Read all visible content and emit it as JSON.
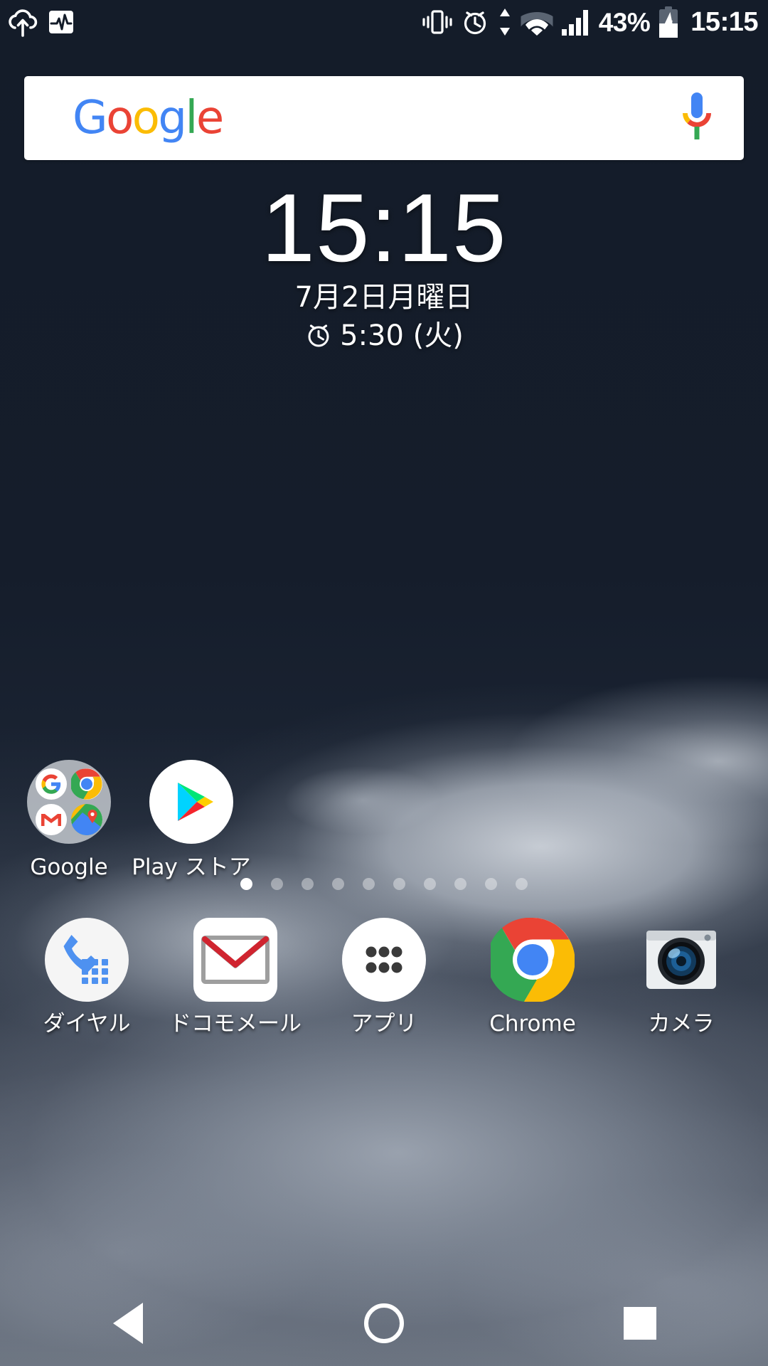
{
  "status_bar": {
    "left_icons": [
      {
        "name": "cloud-upload-icon",
        "label": "cloud upload"
      },
      {
        "name": "activity-pulse-icon",
        "label": "activity monitor"
      }
    ],
    "right_icons": [
      {
        "name": "vibrate-icon",
        "label": "vibrate"
      },
      {
        "name": "alarm-icon",
        "label": "alarm set"
      },
      {
        "name": "data-transfer-icon",
        "label": "data up down"
      },
      {
        "name": "wifi-icon",
        "label": "wifi"
      },
      {
        "name": "cellular-signal-icon",
        "label": "signal bars"
      }
    ],
    "battery_percent": "43%",
    "battery_icon": "battery-charging-icon",
    "clock": "15:15"
  },
  "search_widget": {
    "logo_letters": [
      "G",
      "o",
      "o",
      "g",
      "l",
      "e"
    ],
    "logo_colors": [
      "#4285F4",
      "#EA4335",
      "#FBBC05",
      "#4285F4",
      "#34A853",
      "#EA4335"
    ],
    "mic_icon": "google-mic-icon",
    "placeholder": ""
  },
  "clock_widget": {
    "time": "15:15",
    "date": "7月2日月曜日",
    "alarm_icon": "alarm-clock-icon",
    "alarm_time": "5:30 (火)"
  },
  "home_apps": [
    {
      "label": "Google",
      "icon": "google-folder-icon",
      "type": "folder",
      "folder_items": [
        "google-g-icon",
        "chrome-icon",
        "gmail-icon",
        "maps-icon"
      ]
    },
    {
      "label": "Play ストア",
      "icon": "play-store-icon",
      "type": "app"
    }
  ],
  "page_indicator": {
    "total": 10,
    "active_index": 0
  },
  "dock_apps": [
    {
      "label": "ダイヤル",
      "icon": "dialer-icon"
    },
    {
      "label": "ドコモメール",
      "icon": "docomo-mail-icon"
    },
    {
      "label": "アプリ",
      "icon": "app-drawer-icon"
    },
    {
      "label": "Chrome",
      "icon": "chrome-icon"
    },
    {
      "label": "カメラ",
      "icon": "camera-icon"
    }
  ],
  "nav_bar": {
    "back": "back-button",
    "home": "home-button",
    "recents": "recents-button"
  },
  "colors": {
    "background": "#141c29",
    "accent_blue": "#4285F4",
    "accent_red": "#EA4335",
    "accent_yellow": "#FBBC05",
    "accent_green": "#34A853",
    "status_text": "#ffffff"
  }
}
